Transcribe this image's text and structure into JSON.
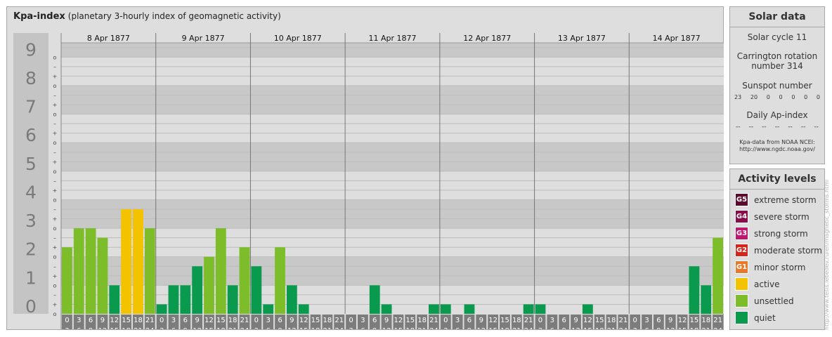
{
  "header": {
    "title": "Kpa-index",
    "subtitle": "(planetary 3-hourly index of geomagnetic activity)"
  },
  "chart_data": {
    "type": "bar",
    "ylim": [
      0,
      9
    ],
    "y_major_ticks": [
      "0",
      "1",
      "2",
      "3",
      "4",
      "5",
      "6",
      "7",
      "8",
      "9"
    ],
    "y_minor_labels": [
      "–",
      "o",
      "+"
    ],
    "days": [
      "8 Apr 1877",
      "9 Apr 1877",
      "10 Apr 1877",
      "11 Apr 1877",
      "12 Apr 1877",
      "13 Apr 1877",
      "14 Apr 1877"
    ],
    "hour_ranges": [
      [
        "0",
        "3"
      ],
      [
        "3",
        "6"
      ],
      [
        "6",
        "9"
      ],
      [
        "9",
        "12"
      ],
      [
        "12",
        "15"
      ],
      [
        "15",
        "18"
      ],
      [
        "18",
        "21"
      ],
      [
        "21",
        "24"
      ]
    ],
    "values": [
      2.333,
      3,
      3,
      2.667,
      1,
      3.667,
      3.667,
      3,
      0.333,
      1,
      1,
      1.667,
      2,
      3,
      1,
      2.333,
      1.667,
      0.333,
      2.333,
      1,
      0.333,
      0,
      0,
      0,
      0,
      0,
      1,
      0.333,
      0,
      0,
      0,
      0.333,
      0.333,
      0,
      0.333,
      0,
      0,
      0,
      0,
      0.333,
      0.333,
      0,
      0,
      0,
      0.333,
      0,
      0,
      0,
      0,
      0,
      0,
      0,
      0,
      1.667,
      1,
      2.667
    ],
    "legend_position": "right",
    "grid": true
  },
  "colors": {
    "quiet": "#0a9a4d",
    "unsettled": "#7dbd2a",
    "active": "#f4c300"
  },
  "solar": {
    "title": "Solar data",
    "cycle": "Solar cycle 11",
    "carrington_line1": "Carrington rotation",
    "carrington_line2": "number 314",
    "sunspot_title": "Sunspot number",
    "sunspots": [
      "23",
      "20",
      "0",
      "0",
      "0",
      "0",
      "0"
    ],
    "ap_title": "Daily Ap-index",
    "ap_values": [
      "--",
      "--",
      "--",
      "--",
      "--",
      "--",
      "--"
    ],
    "credit_line1": "Kpa-data from NOAA NCEI:",
    "credit_line2": "http://www.ngdc.noaa.gov/"
  },
  "activity": {
    "title": "Activity levels",
    "levels": [
      {
        "badge": "G5",
        "label": "extreme storm",
        "color": "#5c0a2e"
      },
      {
        "badge": "G4",
        "label": "severe storm",
        "color": "#8a0c4a"
      },
      {
        "badge": "G3",
        "label": "strong storm",
        "color": "#c0166e"
      },
      {
        "badge": "G2",
        "label": "moderate storm",
        "color": "#d4261c"
      },
      {
        "badge": "G1",
        "label": "minor storm",
        "color": "#e8782a"
      },
      {
        "badge": "",
        "label": "active",
        "color": "#f4c300"
      },
      {
        "badge": "",
        "label": "unsettled",
        "color": "#7dbd2a"
      },
      {
        "badge": "",
        "label": "quiet",
        "color": "#0a9a4d"
      }
    ]
  },
  "watermark": "http://www.tesis.lebedev.ru/en/magnetic_storms.html"
}
